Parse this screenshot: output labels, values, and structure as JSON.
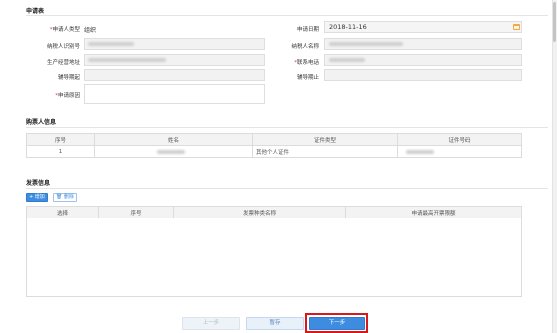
{
  "sections": {
    "application": "申请表",
    "buyer": "购票人信息",
    "invoice": "发票信息"
  },
  "form": {
    "applicant_type_label": "申请人类型",
    "applicant_type_value": "组织",
    "apply_date_label": "申请日期",
    "apply_date_value": "2018-11-16",
    "taxpayer_id_label": "纳税人识别号",
    "taxpayer_name_label": "纳税人名称",
    "business_address_label": "生产经营地址",
    "phone_label": "联系电话",
    "counsel_start_label": "辅导期起",
    "counsel_end_label": "辅导期止",
    "reason_label": "申请原因",
    "required_mark": "*"
  },
  "buyer_table": {
    "headers": [
      "序号",
      "姓名",
      "证件类型",
      "证件号码"
    ],
    "rows": [
      {
        "index": "1",
        "id_type": "其他个人证件"
      }
    ]
  },
  "invoice_toolbar": {
    "add_label": "+ 增加",
    "delete_label": "🗑 删除"
  },
  "invoice_table": {
    "headers": [
      "选择",
      "序号",
      "发票种类名称",
      "申请最高开票限额"
    ]
  },
  "footer": {
    "prev_label": "上一步",
    "save_label": "暂存",
    "next_label": "下一步"
  }
}
